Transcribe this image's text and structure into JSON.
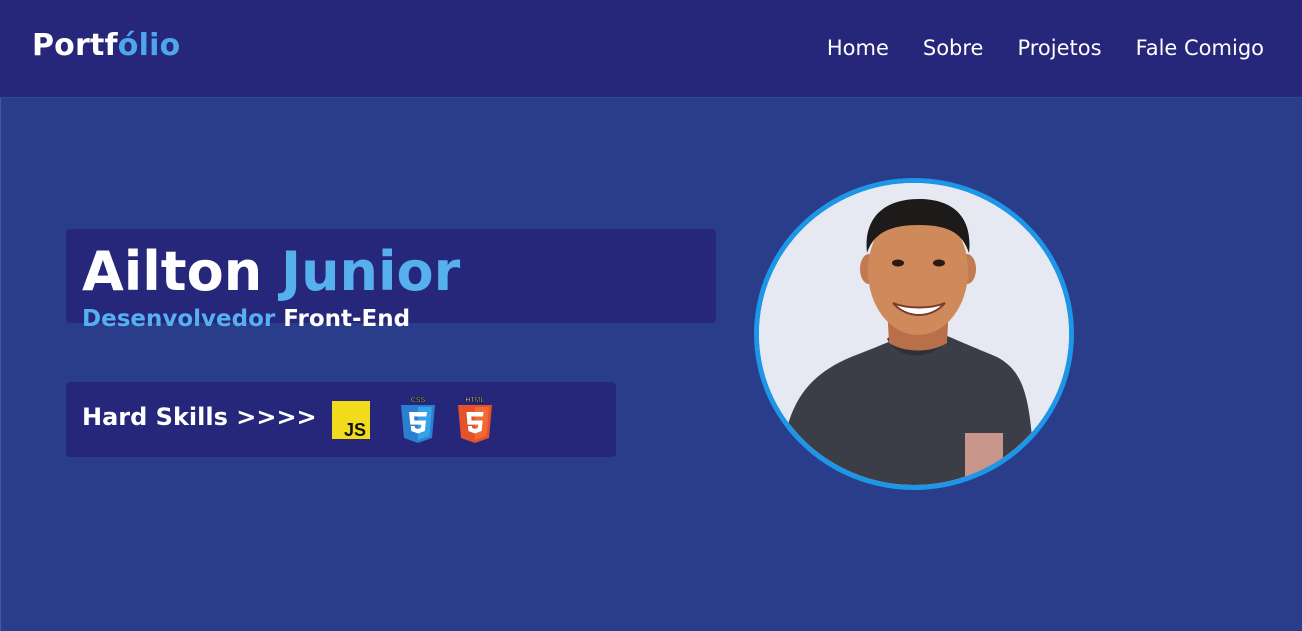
{
  "navbar": {
    "logo_part1": "Portf",
    "logo_part2": "ólio",
    "links": [
      {
        "label": "Home"
      },
      {
        "label": "Sobre"
      },
      {
        "label": "Projetos"
      },
      {
        "label": "Fale Comigo"
      }
    ]
  },
  "hero": {
    "first_name": "Ailton",
    "last_name": "Junior",
    "role_accent": "Desenvolvedor",
    "role_rest": "Front-End",
    "skills_label": "Hard Skills >>>>",
    "skills": [
      {
        "icon": "javascript-icon",
        "text": "JS",
        "color": "#f0db1d"
      },
      {
        "icon": "css3-icon",
        "text": "CSS",
        "color": "#2a7fd1"
      },
      {
        "icon": "html5-icon",
        "text": "HTML",
        "color": "#e4522b"
      }
    ]
  },
  "colors": {
    "background": "#2a3d8a",
    "navbar": "#26267a",
    "accent": "#56b0ee",
    "avatar_ring": "#1e96e8"
  }
}
